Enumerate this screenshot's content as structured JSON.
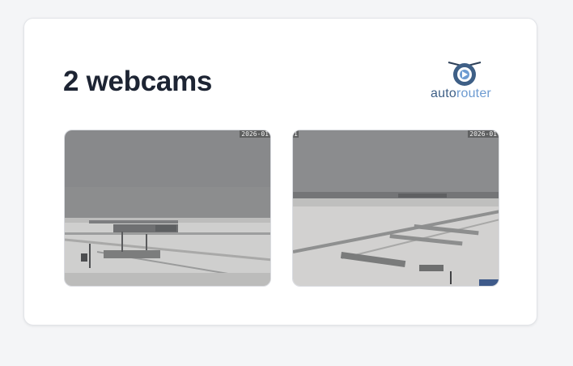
{
  "header": {
    "title": "2 webcams"
  },
  "logo": {
    "icon": "autorouter-drone-icon",
    "text_part1": "auto",
    "text_part2": "router"
  },
  "webcams": [
    {
      "timestamp": "2026-01",
      "scene": "snowy airfield with hangars and aircraft"
    },
    {
      "timestamp": "2026-01",
      "left_stamp": "1",
      "scene": "snowy runway taxiway markings"
    }
  ],
  "colors": {
    "title": "#1d2433",
    "logo_dark": "#3e5f86",
    "logo_light": "#6d9bd1",
    "sky": "#8a8b8d",
    "snow": "#d6d5d4"
  }
}
